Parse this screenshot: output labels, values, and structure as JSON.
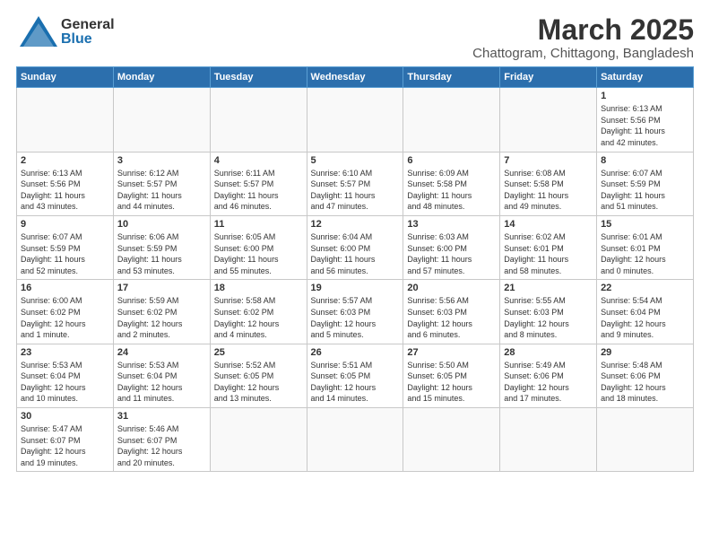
{
  "header": {
    "logo": {
      "line1": "General",
      "line2": "Blue"
    },
    "title": "March 2025",
    "subtitle": "Chattogram, Chittagong, Bangladesh"
  },
  "weekdays": [
    "Sunday",
    "Monday",
    "Tuesday",
    "Wednesday",
    "Thursday",
    "Friday",
    "Saturday"
  ],
  "weeks": [
    [
      {
        "day": "",
        "info": ""
      },
      {
        "day": "",
        "info": ""
      },
      {
        "day": "",
        "info": ""
      },
      {
        "day": "",
        "info": ""
      },
      {
        "day": "",
        "info": ""
      },
      {
        "day": "",
        "info": ""
      },
      {
        "day": "1",
        "info": "Sunrise: 6:13 AM\nSunset: 5:56 PM\nDaylight: 11 hours\nand 42 minutes."
      }
    ],
    [
      {
        "day": "2",
        "info": "Sunrise: 6:13 AM\nSunset: 5:56 PM\nDaylight: 11 hours\nand 43 minutes."
      },
      {
        "day": "3",
        "info": "Sunrise: 6:12 AM\nSunset: 5:57 PM\nDaylight: 11 hours\nand 44 minutes."
      },
      {
        "day": "4",
        "info": "Sunrise: 6:11 AM\nSunset: 5:57 PM\nDaylight: 11 hours\nand 46 minutes."
      },
      {
        "day": "5",
        "info": "Sunrise: 6:10 AM\nSunset: 5:57 PM\nDaylight: 11 hours\nand 47 minutes."
      },
      {
        "day": "6",
        "info": "Sunrise: 6:09 AM\nSunset: 5:58 PM\nDaylight: 11 hours\nand 48 minutes."
      },
      {
        "day": "7",
        "info": "Sunrise: 6:08 AM\nSunset: 5:58 PM\nDaylight: 11 hours\nand 49 minutes."
      },
      {
        "day": "8",
        "info": "Sunrise: 6:07 AM\nSunset: 5:59 PM\nDaylight: 11 hours\nand 51 minutes."
      }
    ],
    [
      {
        "day": "9",
        "info": "Sunrise: 6:07 AM\nSunset: 5:59 PM\nDaylight: 11 hours\nand 52 minutes."
      },
      {
        "day": "10",
        "info": "Sunrise: 6:06 AM\nSunset: 5:59 PM\nDaylight: 11 hours\nand 53 minutes."
      },
      {
        "day": "11",
        "info": "Sunrise: 6:05 AM\nSunset: 6:00 PM\nDaylight: 11 hours\nand 55 minutes."
      },
      {
        "day": "12",
        "info": "Sunrise: 6:04 AM\nSunset: 6:00 PM\nDaylight: 11 hours\nand 56 minutes."
      },
      {
        "day": "13",
        "info": "Sunrise: 6:03 AM\nSunset: 6:00 PM\nDaylight: 11 hours\nand 57 minutes."
      },
      {
        "day": "14",
        "info": "Sunrise: 6:02 AM\nSunset: 6:01 PM\nDaylight: 11 hours\nand 58 minutes."
      },
      {
        "day": "15",
        "info": "Sunrise: 6:01 AM\nSunset: 6:01 PM\nDaylight: 12 hours\nand 0 minutes."
      }
    ],
    [
      {
        "day": "16",
        "info": "Sunrise: 6:00 AM\nSunset: 6:02 PM\nDaylight: 12 hours\nand 1 minute."
      },
      {
        "day": "17",
        "info": "Sunrise: 5:59 AM\nSunset: 6:02 PM\nDaylight: 12 hours\nand 2 minutes."
      },
      {
        "day": "18",
        "info": "Sunrise: 5:58 AM\nSunset: 6:02 PM\nDaylight: 12 hours\nand 4 minutes."
      },
      {
        "day": "19",
        "info": "Sunrise: 5:57 AM\nSunset: 6:03 PM\nDaylight: 12 hours\nand 5 minutes."
      },
      {
        "day": "20",
        "info": "Sunrise: 5:56 AM\nSunset: 6:03 PM\nDaylight: 12 hours\nand 6 minutes."
      },
      {
        "day": "21",
        "info": "Sunrise: 5:55 AM\nSunset: 6:03 PM\nDaylight: 12 hours\nand 8 minutes."
      },
      {
        "day": "22",
        "info": "Sunrise: 5:54 AM\nSunset: 6:04 PM\nDaylight: 12 hours\nand 9 minutes."
      }
    ],
    [
      {
        "day": "23",
        "info": "Sunrise: 5:53 AM\nSunset: 6:04 PM\nDaylight: 12 hours\nand 10 minutes."
      },
      {
        "day": "24",
        "info": "Sunrise: 5:53 AM\nSunset: 6:04 PM\nDaylight: 12 hours\nand 11 minutes."
      },
      {
        "day": "25",
        "info": "Sunrise: 5:52 AM\nSunset: 6:05 PM\nDaylight: 12 hours\nand 13 minutes."
      },
      {
        "day": "26",
        "info": "Sunrise: 5:51 AM\nSunset: 6:05 PM\nDaylight: 12 hours\nand 14 minutes."
      },
      {
        "day": "27",
        "info": "Sunrise: 5:50 AM\nSunset: 6:05 PM\nDaylight: 12 hours\nand 15 minutes."
      },
      {
        "day": "28",
        "info": "Sunrise: 5:49 AM\nSunset: 6:06 PM\nDaylight: 12 hours\nand 17 minutes."
      },
      {
        "day": "29",
        "info": "Sunrise: 5:48 AM\nSunset: 6:06 PM\nDaylight: 12 hours\nand 18 minutes."
      }
    ],
    [
      {
        "day": "30",
        "info": "Sunrise: 5:47 AM\nSunset: 6:07 PM\nDaylight: 12 hours\nand 19 minutes."
      },
      {
        "day": "31",
        "info": "Sunrise: 5:46 AM\nSunset: 6:07 PM\nDaylight: 12 hours\nand 20 minutes."
      },
      {
        "day": "",
        "info": ""
      },
      {
        "day": "",
        "info": ""
      },
      {
        "day": "",
        "info": ""
      },
      {
        "day": "",
        "info": ""
      },
      {
        "day": "",
        "info": ""
      }
    ]
  ]
}
